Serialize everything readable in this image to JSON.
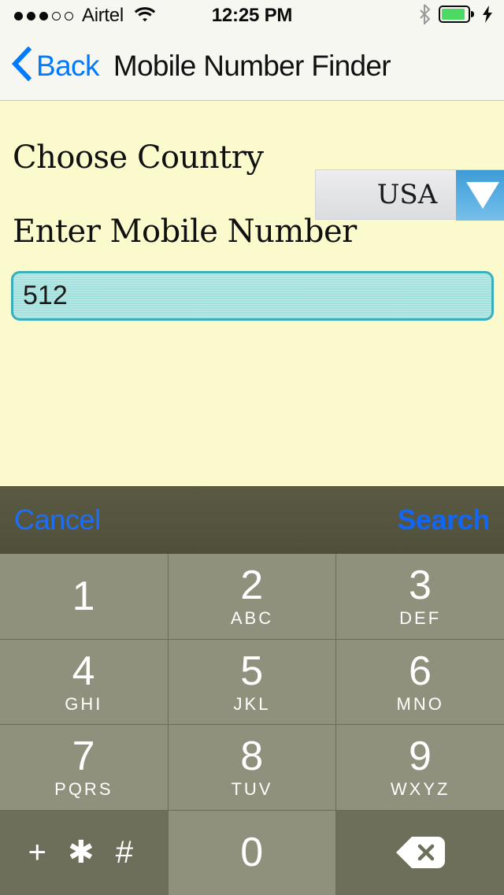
{
  "status_bar": {
    "signal_dots_filled": 3,
    "signal_dots_total": 5,
    "carrier": "Airtel",
    "wifi_icon": "wifi-icon",
    "time": "12:25 PM",
    "bluetooth_icon": "bluetooth-icon",
    "battery_icon": "battery-icon",
    "battery_level_percent": 80,
    "charging_icon": "lightning-bolt-icon",
    "battery_color": "#4CD964",
    "background": "#F7F7F2"
  },
  "nav_bar": {
    "back_label": "Back",
    "back_chevron_icon": "chevron-left-icon",
    "title": "Mobile Number Finder",
    "accent_color": "#007AFF",
    "background": "#F7F7F2"
  },
  "content": {
    "background": "#FAFACD",
    "country_label": "Choose Country",
    "country_dropdown": {
      "selected": "USA",
      "arrow_icon": "triangle-down-icon",
      "arrow_bg": "#5BB0E3"
    },
    "mobile_label": "Enter Mobile Number",
    "mobile_input": {
      "value": "512",
      "placeholder": "",
      "border_color": "#3AAFBB",
      "fill_color": "#A2E0DD"
    }
  },
  "keyboard": {
    "toolbar": {
      "cancel_label": "Cancel",
      "search_label": "Search",
      "background": "#55553F",
      "cancel_color": "#1C6EF5",
      "search_color": "#1166F6"
    },
    "key_color": "#90917C",
    "key_dark_color": "#6E6F5B",
    "separator_color": "#6B6C58",
    "keys": [
      {
        "digit": "1",
        "letters": ""
      },
      {
        "digit": "2",
        "letters": "ABC"
      },
      {
        "digit": "3",
        "letters": "DEF"
      },
      {
        "digit": "4",
        "letters": "GHI"
      },
      {
        "digit": "5",
        "letters": "JKL"
      },
      {
        "digit": "6",
        "letters": "MNO"
      },
      {
        "digit": "7",
        "letters": "PQRS"
      },
      {
        "digit": "8",
        "letters": "TUV"
      },
      {
        "digit": "9",
        "letters": "WXYZ"
      },
      {
        "digit": "+ ✱ #",
        "letters": "",
        "dark": true,
        "name": "symbols"
      },
      {
        "digit": "0",
        "letters": ""
      },
      {
        "digit": "",
        "letters": "",
        "dark": true,
        "name": "backspace",
        "icon": "backspace-icon"
      }
    ]
  }
}
